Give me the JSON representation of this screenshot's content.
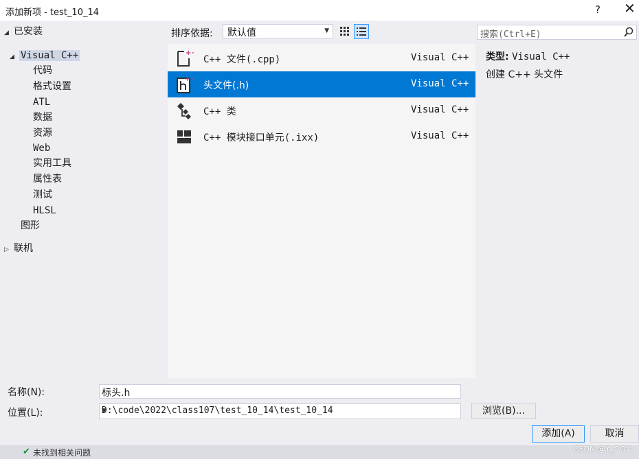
{
  "window": {
    "title": "添加新项 - test_10_14",
    "help": "?",
    "close": "✕"
  },
  "tree": {
    "installed": "已安装",
    "visual_cpp": "Visual C++",
    "children": [
      "代码",
      "格式设置",
      "ATL",
      "数据",
      "资源",
      "Web",
      "实用工具",
      "属性表",
      "测试",
      "HLSL"
    ],
    "graphics": "图形",
    "online": "联机"
  },
  "toolbar": {
    "sort_label": "排序依据:",
    "sort_value": "默认值"
  },
  "search": {
    "placeholder": "搜索(Ctrl+E)"
  },
  "templates": [
    {
      "name": "C++ 文件(.cpp)",
      "lang": "Visual C++",
      "icon": "cpp-file-icon"
    },
    {
      "name": "头文件(.h)",
      "lang": "Visual C++",
      "icon": "header-file-icon",
      "selected": true
    },
    {
      "name": "C++ 类",
      "lang": "Visual C++",
      "icon": "class-icon"
    },
    {
      "name": "C++ 模块接口单元(.ixx)",
      "lang": "Visual C++",
      "icon": "module-icon"
    }
  ],
  "details": {
    "type_label": "类型:",
    "type_value": "Visual C++",
    "description": "创建 C++ 头文件"
  },
  "form": {
    "name_label": "名称(N):",
    "name_value": "标头.h",
    "location_label": "位置(L):",
    "location_value": "D:\\code\\2022\\class107\\test_10_14\\test_10_14",
    "browse_label": "浏览(B)...",
    "add_label": "添加(A)",
    "cancel_label": "取消"
  },
  "status": {
    "text": "未找到相关问题"
  },
  "watermark": "CSDN @Y_^O^",
  "colors": {
    "selection": "#0078d4",
    "list_bg": "#f5f5f5",
    "dialog_bg": "#eeeef2",
    "icon_accent": "#c0327a"
  }
}
